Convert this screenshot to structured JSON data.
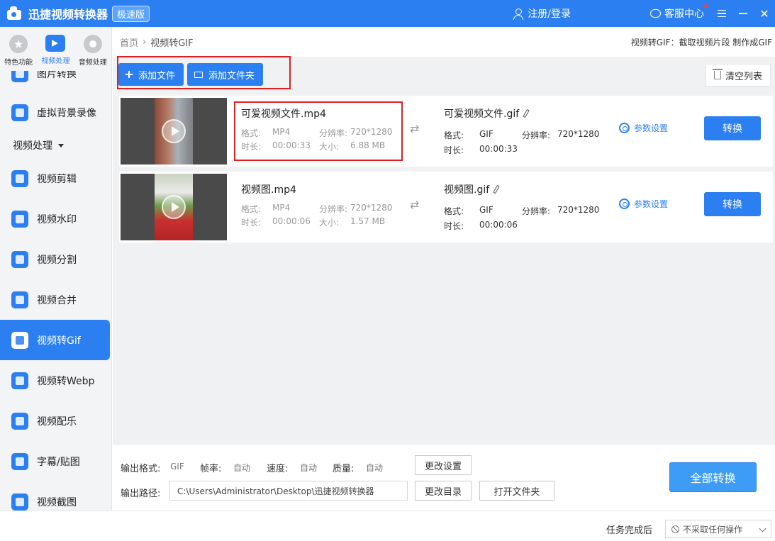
{
  "app": {
    "title": "迅捷视频转换器",
    "edition_badge": "极速版",
    "login": "注册/登录",
    "service": "客服中心"
  },
  "sidebar": {
    "categories": [
      {
        "label": "特色功能",
        "icon": "star-icon"
      },
      {
        "label": "视频处理",
        "icon": "film-icon"
      },
      {
        "label": "音频处理",
        "icon": "disc-icon"
      }
    ],
    "items_top": [
      {
        "label": "图片转换",
        "icon": "image-convert-icon"
      },
      {
        "label": "虚拟背景录像",
        "icon": "virtual-background-icon"
      }
    ],
    "section": "视频处理",
    "items": [
      {
        "label": "视频剪辑",
        "icon": "video-cut-icon"
      },
      {
        "label": "视频水印",
        "icon": "watermark-icon"
      },
      {
        "label": "视频分割",
        "icon": "video-split-icon"
      },
      {
        "label": "视频合并",
        "icon": "video-merge-icon"
      },
      {
        "label": "视频转Gif",
        "icon": "gif-icon"
      },
      {
        "label": "视频转Webp",
        "icon": "webp-icon"
      },
      {
        "label": "视频配乐",
        "icon": "music-icon"
      },
      {
        "label": "字幕/贴图",
        "icon": "sticker-icon"
      },
      {
        "label": "视频截图",
        "icon": "screenshot-icon"
      }
    ]
  },
  "breadcrumb": {
    "home": "首页",
    "separator": "›",
    "current": "视频转GIF",
    "description": "视频转GIF：截取视频片段 制作成GIF"
  },
  "toolbar": {
    "add_file": "添加文件",
    "add_folder": "添加文件夹",
    "clear_list": "清空列表"
  },
  "labels": {
    "format": "格式:",
    "resolution": "分辨率:",
    "duration": "时长:",
    "size": "大小:",
    "params": "参数设置",
    "convert": "转换"
  },
  "files": [
    {
      "src_name": "可爱视频文件.mp4",
      "src_format": "MP4",
      "src_resolution": "720*1280",
      "src_duration": "00:00:33",
      "src_size": "6.88 MB",
      "out_name": "可爱视频文件.gif",
      "out_format": "GIF",
      "out_resolution": "720*1280",
      "out_duration": "00:00:33"
    },
    {
      "src_name": "视频图.mp4",
      "src_format": "MP4",
      "src_resolution": "720*1280",
      "src_duration": "00:00:06",
      "src_size": "1.57 MB",
      "out_name": "视频图.gif",
      "out_format": "GIF",
      "out_resolution": "720*1280",
      "out_duration": "00:00:06"
    }
  ],
  "settings": {
    "output_format_label": "输出格式:",
    "output_format": "GIF",
    "fps_label": "帧率:",
    "fps": "自动",
    "speed_label": "速度:",
    "speed": "自动",
    "quality_label": "质量:",
    "quality": "自动",
    "change_settings": "更改设置",
    "output_path_label": "输出路径:",
    "output_path": "C:\\Users\\Administrator\\Desktop\\迅捷视频转换器",
    "change_dir": "更改目录",
    "open_folder": "打开文件夹",
    "convert_all": "全部转换"
  },
  "status": {
    "after_task_label": "任务完成后",
    "after_task_option": "不采取任何操作"
  },
  "colors": {
    "accent": "#2b7ff0",
    "highlight_box": "#e02020"
  }
}
